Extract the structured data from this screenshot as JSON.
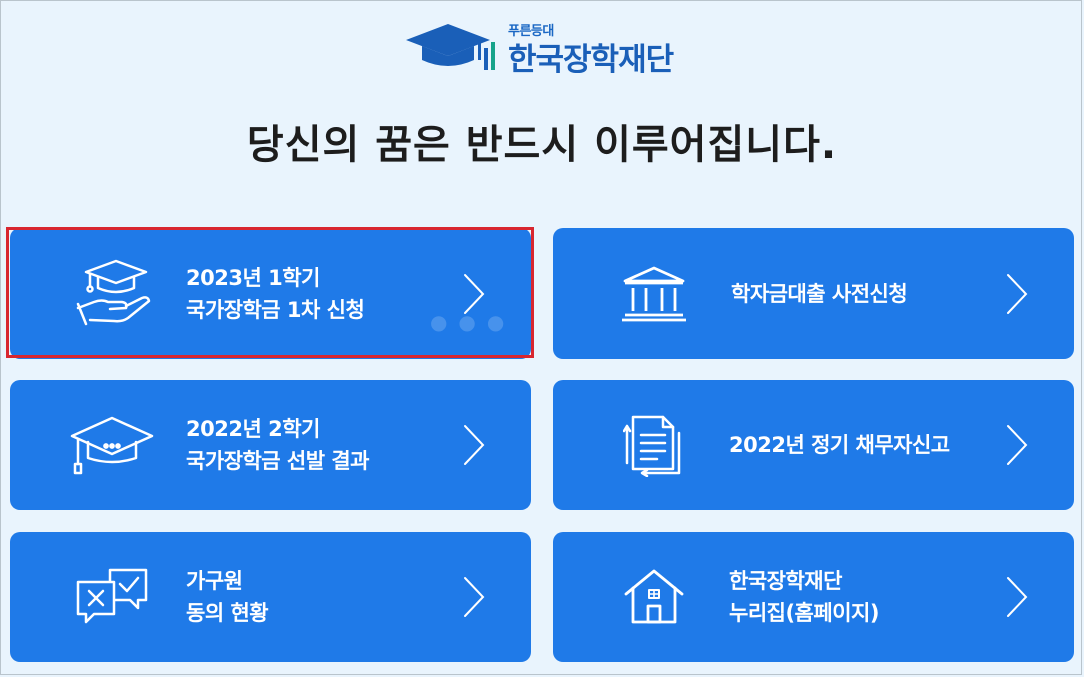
{
  "logo": {
    "sub": "푸른등대",
    "name": "한국장학재단"
  },
  "headline": "당신의 꿈은 반드시 이루어집니다.",
  "cards": [
    {
      "line1": "2023년 1학기",
      "line2": "국가장학금 1차 신청",
      "icon": "graduation-cap-hand-icon",
      "selected": true
    },
    {
      "line1": "학자금대출 사전신청",
      "line2": "",
      "icon": "bank-building-icon",
      "selected": false
    },
    {
      "line1": "2022년 2학기",
      "line2": "국가장학금 선발 결과",
      "icon": "graduation-cap-icon",
      "selected": false
    },
    {
      "line1": "2022년 정기 채무자신고",
      "line2": "",
      "icon": "document-refresh-icon",
      "selected": false
    },
    {
      "line1": "가구원",
      "line2": "동의 현황",
      "icon": "consent-chat-icon",
      "selected": false
    },
    {
      "line1": "한국장학재단",
      "line2": "누리집(홈페이지)",
      "icon": "home-icon",
      "selected": false
    }
  ],
  "colors": {
    "card": "#1f7ae8",
    "background": "#e9f4fd",
    "selection": "#d8262f",
    "brand": "#1a5fb8"
  }
}
